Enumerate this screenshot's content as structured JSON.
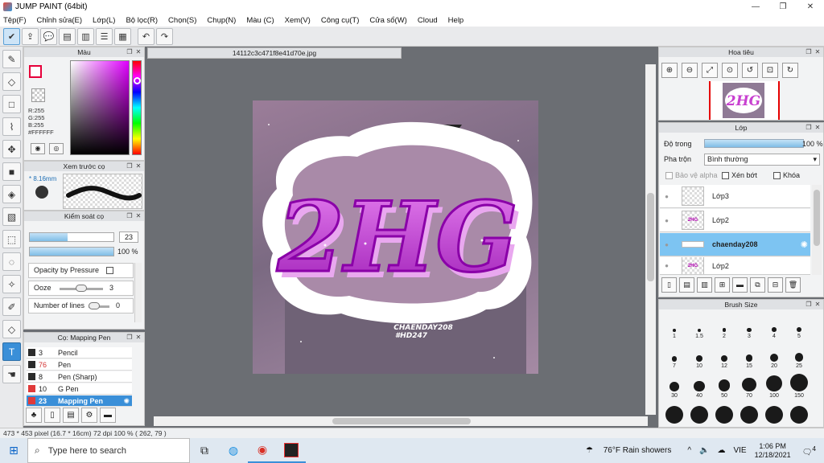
{
  "window": {
    "title": "JUMP PAINT (64bit)"
  },
  "menu": [
    "Tệp(F)",
    "Chỉnh sửa(E)",
    "Lớp(L)",
    "Bộ lọc(R)",
    "Chọn(S)",
    "Chụp(N)",
    "Màu (C)",
    "Xem(V)",
    "Công cụ(T)",
    "Cửa sổ(W)",
    "Cloud",
    "Help"
  ],
  "panels": {
    "color": {
      "title": "Màu",
      "r": "R:255",
      "g": "G:255",
      "b": "B:255",
      "hex": "#FFFFFF"
    },
    "brush_preview": {
      "title": "Xem trước cọ",
      "size": "8.16mm"
    },
    "brush_control": {
      "title": "Kiểm soát cọ",
      "size_value": "23",
      "opacity_value": "100 %",
      "opacity_by_pressure": "Opacity by Pressure",
      "ooze_label": "Ooze",
      "ooze_value": "3",
      "lines_label": "Number of lines",
      "lines_value": "0"
    },
    "pen_list": {
      "title": "Cọ: Mapping Pen",
      "items": [
        {
          "num": "3",
          "name": "Pencil",
          "color": "#2b2b2b"
        },
        {
          "num": "76",
          "name": "Pen",
          "color": "#2b2b2b",
          "num_color": "#d23030"
        },
        {
          "num": "8",
          "name": "Pen (Sharp)",
          "color": "#2b2b2b"
        },
        {
          "num": "10",
          "name": "G Pen",
          "color": "#e03a3a"
        },
        {
          "num": "23",
          "name": "Mapping Pen",
          "color": "#e03a3a"
        }
      ]
    },
    "navigator": {
      "title": "Hoa tiêu"
    },
    "layer": {
      "title": "Lớp",
      "opacity_label": "Độ trong",
      "opacity_value": "100 %",
      "blend_label": "Pha trộn",
      "blend_value": "Bình thường",
      "protect_alpha": "Bảo vệ alpha",
      "clipping": "Xén bớt",
      "lock": "Khóa",
      "layers": [
        {
          "name": "Lớp3",
          "thumb": ""
        },
        {
          "name": "Lớp2",
          "thumb": "2HG"
        },
        {
          "name": "chaenday208",
          "thumb": ""
        },
        {
          "name": "Lớp2",
          "thumb": "2HG"
        }
      ]
    },
    "brush_size": {
      "title": "Brush Size",
      "sizes": [
        "1",
        "1.5",
        "2",
        "3",
        "4",
        "5",
        "7",
        "10",
        "12",
        "15",
        "20",
        "25",
        "30",
        "40",
        "50",
        "70",
        "100",
        "150"
      ]
    }
  },
  "canvas": {
    "doc_tab": "14112c3c471f8e41d70e.jpg",
    "art_text": "2HG",
    "signature_line1": "CHAENDAY208",
    "signature_line2": "#HD247"
  },
  "status": "473 * 453 pixel   (16.7 * 16cm)   72 dpi   100 %   ( 262, 79 )",
  "taskbar": {
    "search_placeholder": "Type here to search",
    "weather": "76°F  Rain showers",
    "lang": "VIE",
    "time": "1:06 PM",
    "date": "12/18/2021",
    "notifications": "4"
  },
  "colors": {
    "accent": "#3a8fd8",
    "fg_swatch_border": "#e6003a",
    "bg_swatch": "#c800c8",
    "canvas_bg": "#6b6e73",
    "art_purple": "#c840d0"
  }
}
